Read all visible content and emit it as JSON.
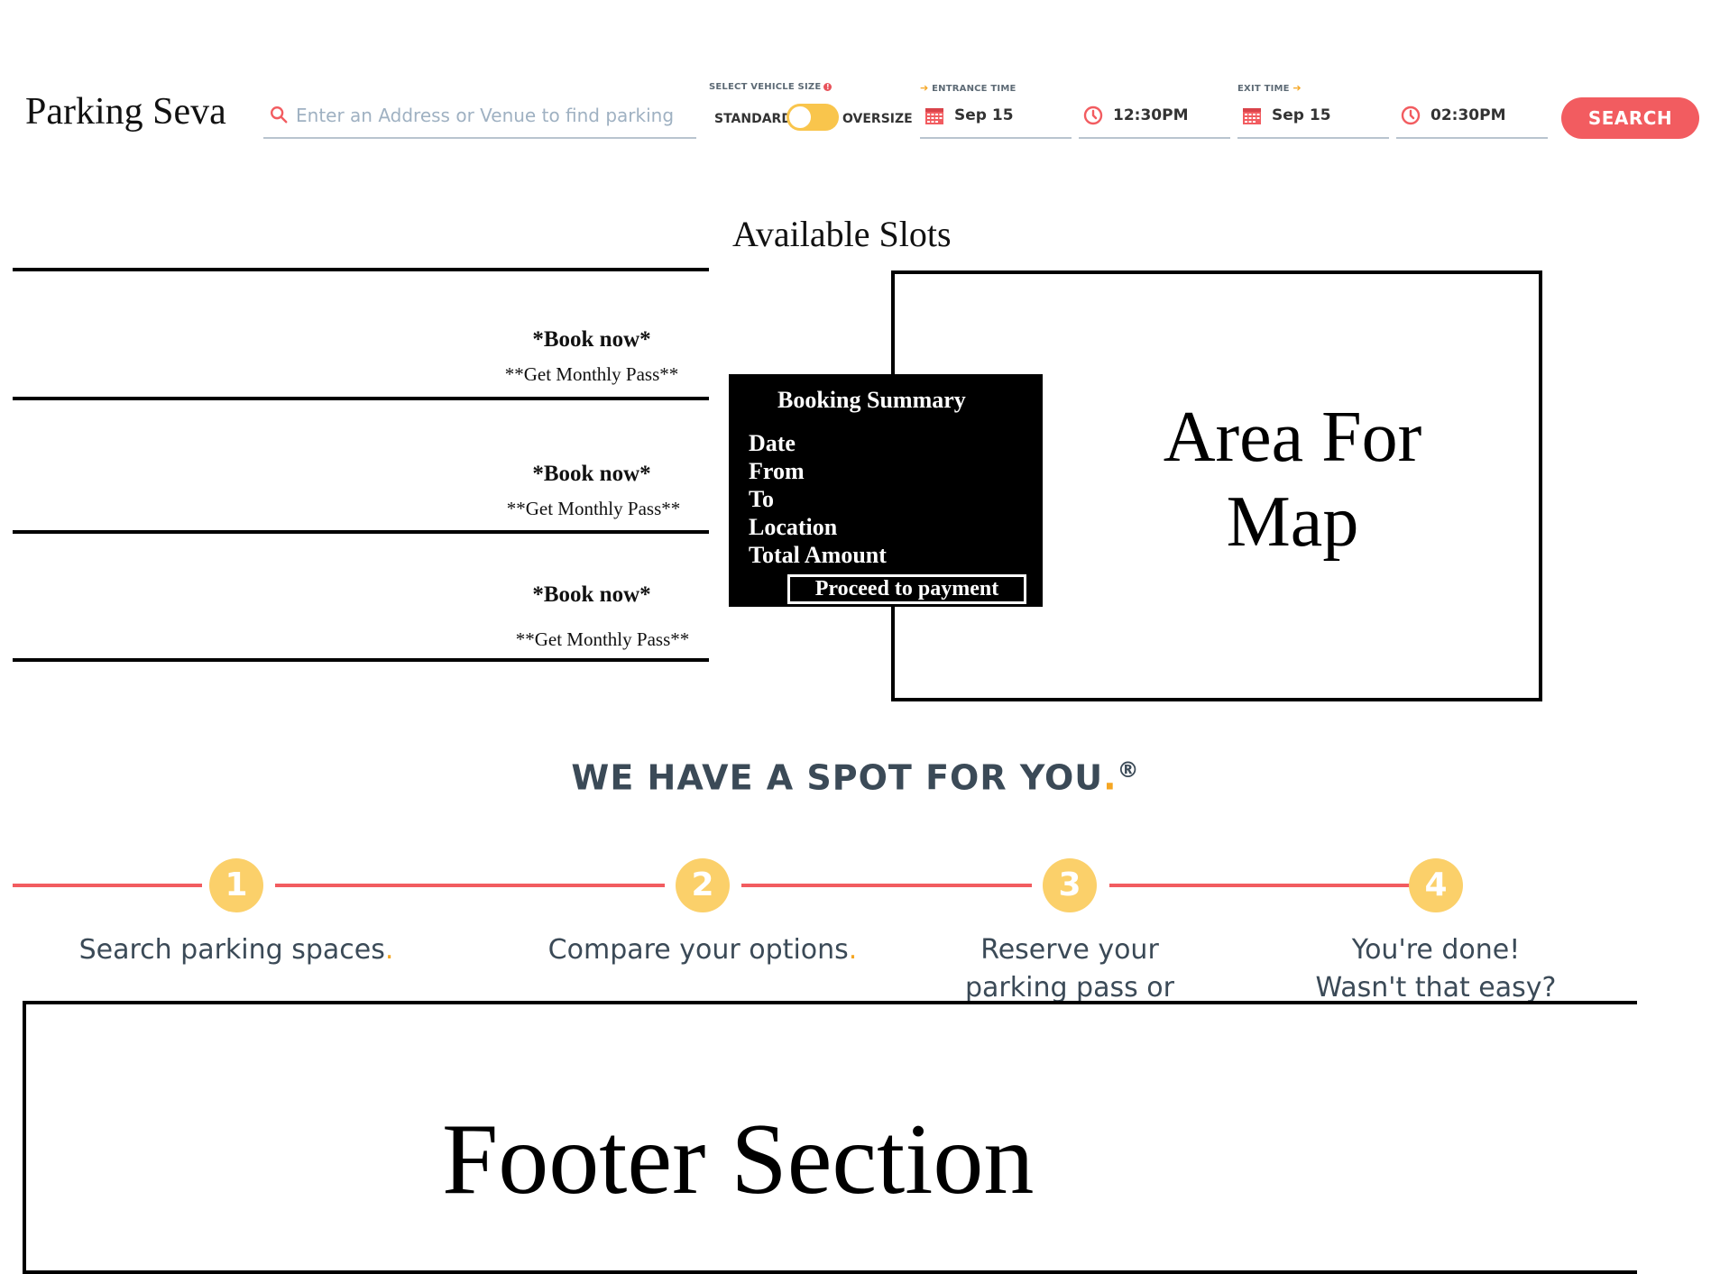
{
  "header": {
    "logo": "Parking Seva",
    "search": {
      "placeholder": "Enter an Address or Venue to find parking",
      "value": "",
      "icon": "search-icon"
    },
    "vehicle": {
      "label": "SELECT VEHICLE SIZE",
      "standard": "STANDARD",
      "oversize": "OVERSIZE",
      "selected": "STANDARD"
    },
    "entrance": {
      "label": "ENTRANCE TIME",
      "date": "Sep 15",
      "time": "12:30PM"
    },
    "exit": {
      "label": "EXIT TIME",
      "date": "Sep 15",
      "time": "02:30PM"
    },
    "search_button": "SEARCH",
    "accent_color": "#f25c60",
    "highlight_color": "#f9c54c"
  },
  "slots": {
    "title": "Available Slots",
    "items": [
      {
        "book": "*Book now*",
        "pass": "**Get Monthly Pass**"
      },
      {
        "book": "*Book now*",
        "pass": "**Get Monthly Pass**"
      },
      {
        "book": "*Book now*",
        "pass": "**Get Monthly Pass**"
      }
    ]
  },
  "map": {
    "line1": "Area For",
    "line2": "Map"
  },
  "summary": {
    "title": "Booking Summary",
    "rows": [
      "Date",
      "From",
      "To",
      "Location",
      "Total Amount"
    ],
    "button": "Proceed to payment"
  },
  "how": {
    "title": "WE HAVE A SPOT FOR YOU",
    "title_dot": ".",
    "registered": "®",
    "steps": [
      {
        "num": "1",
        "text": "Search parking spaces",
        "dot": "."
      },
      {
        "num": "2",
        "text": "Compare your options",
        "dot": "."
      },
      {
        "num": "3",
        "text": "Reserve your parking pass or drive up",
        "dot": ""
      },
      {
        "num": "4",
        "text_line1": "You're done!",
        "text_line2": "Wasn't that easy?"
      }
    ]
  },
  "footer": {
    "text": "Footer Section"
  }
}
